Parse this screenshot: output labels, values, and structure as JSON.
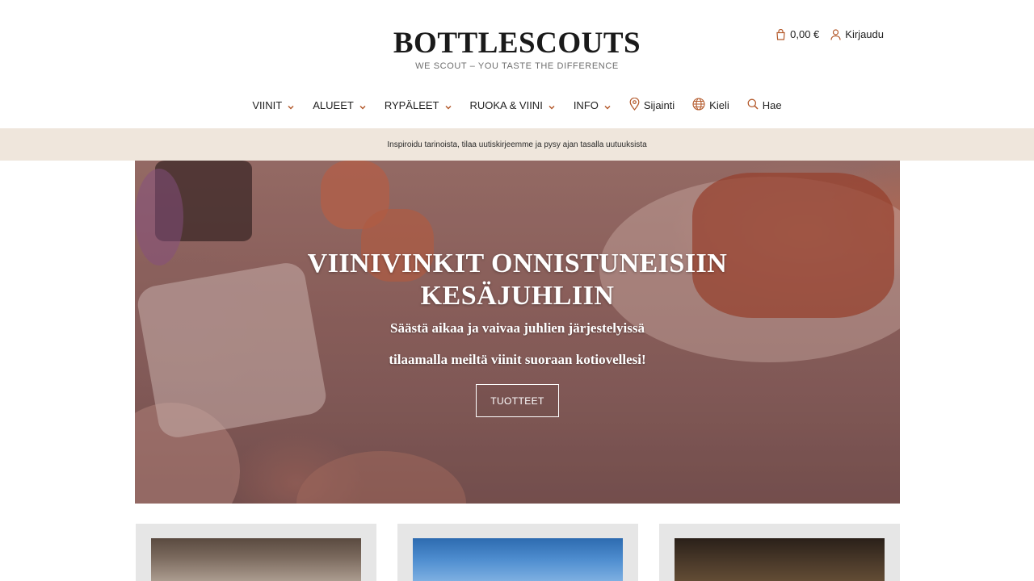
{
  "header": {
    "logo": "BOTTLESCOUTS",
    "tagline": "WE SCOUT – YOU TASTE THE DIFFERENCE",
    "cart_amount": "0,00 €",
    "login_label": "Kirjaudu"
  },
  "nav": {
    "items": [
      {
        "label": "VIINIT"
      },
      {
        "label": "ALUEET"
      },
      {
        "label": "RYPÄLEET"
      },
      {
        "label": "RUOKA & VIINI"
      },
      {
        "label": "INFO"
      }
    ],
    "location_label": "Sijainti",
    "language_label": "Kieli",
    "search_label": "Hae"
  },
  "promo": {
    "text": "Inspiroidu tarinoista, tilaa uutiskirjeemme ja pysy ajan tasalla uutuuksista"
  },
  "hero": {
    "title_line1": "VIINIVINKIT ONNISTUNEISIIN",
    "title_line2": "KESÄJUHLIIN",
    "subtitle_line1": "Säästä aikaa ja vaivaa juhlien järjestelyissä",
    "subtitle_line2": "tilaamalla meiltä viinit suoraan kotiovellesi!",
    "button_label": "TUOTTEET"
  },
  "colors": {
    "accent": "#b45a2c",
    "promo_bg": "#efe6dc",
    "card_bg": "#e6e6e6"
  }
}
